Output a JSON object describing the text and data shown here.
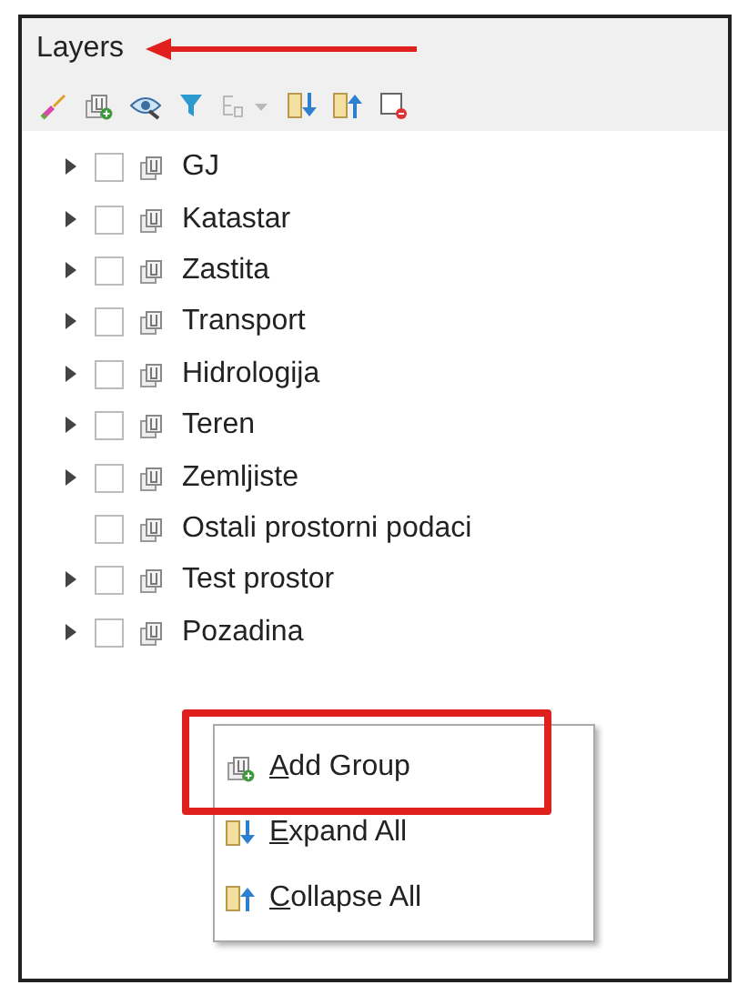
{
  "panel": {
    "title": "Layers"
  },
  "toolbar": [
    {
      "kind": "style",
      "disabled": false
    },
    {
      "kind": "group",
      "disabled": false
    },
    {
      "kind": "eye",
      "disabled": false
    },
    {
      "kind": "filter",
      "disabled": false
    },
    {
      "kind": "expression",
      "disabled": true
    },
    {
      "kind": "expand",
      "disabled": false
    },
    {
      "kind": "collapse",
      "disabled": false
    },
    {
      "kind": "remove",
      "disabled": false
    }
  ],
  "layers": [
    {
      "name": "GJ",
      "has_children": true,
      "checked": false
    },
    {
      "name": "Katastar",
      "has_children": true,
      "checked": false
    },
    {
      "name": "Zastita",
      "has_children": true,
      "checked": false
    },
    {
      "name": "Transport",
      "has_children": true,
      "checked": false
    },
    {
      "name": "Hidrologija",
      "has_children": true,
      "checked": false
    },
    {
      "name": "Teren",
      "has_children": true,
      "checked": false
    },
    {
      "name": "Zemljiste",
      "has_children": true,
      "checked": false
    },
    {
      "name": "Ostali prostorni podaci",
      "has_children": false,
      "checked": false
    },
    {
      "name": "Test prostor",
      "has_children": true,
      "checked": false
    },
    {
      "name": "Pozadina",
      "has_children": true,
      "checked": false
    }
  ],
  "context_menu": [
    {
      "kind": "group",
      "key": "A",
      "rest": "dd Group",
      "highlighted": true
    },
    {
      "kind": "expand",
      "key": "E",
      "rest": "xpand All",
      "highlighted": false
    },
    {
      "kind": "collapse",
      "key": "C",
      "rest": "ollapse All",
      "highlighted": false
    }
  ]
}
